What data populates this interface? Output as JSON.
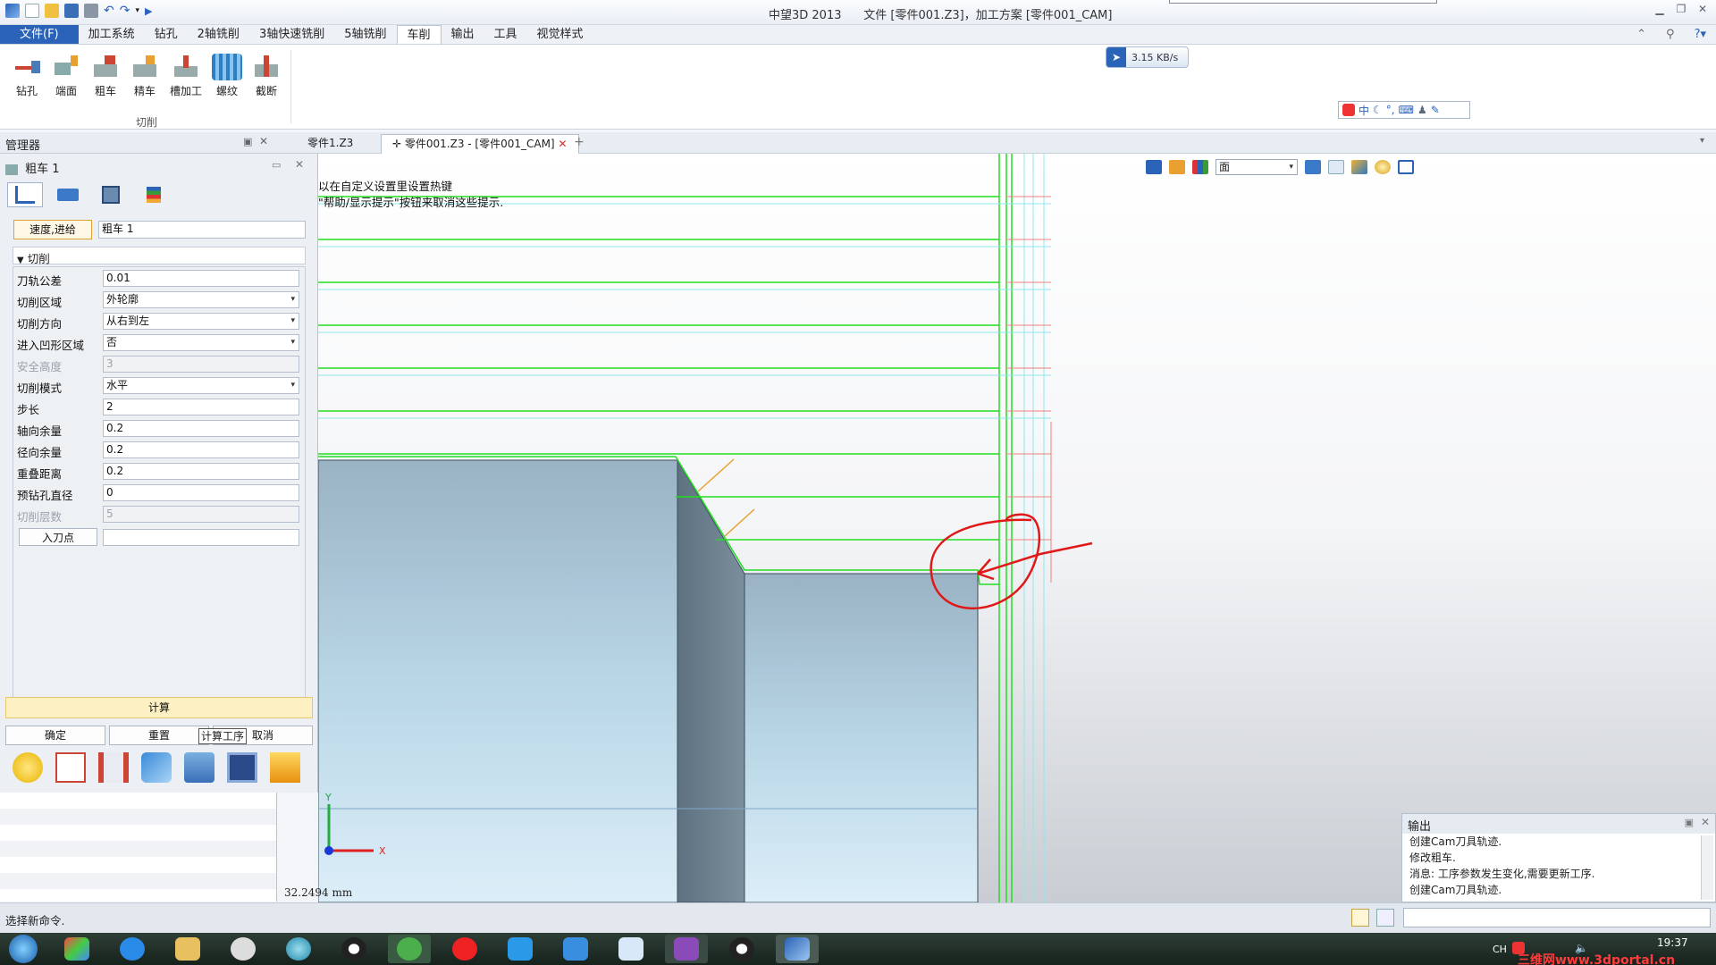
{
  "window": {
    "app_name": "中望3D 2013",
    "doc_title": "文件 [零件001.Z3]，加工方案 [零件001_CAM]"
  },
  "menu": [
    "文件(F)",
    "加工系统",
    "钻孔",
    "2轴铣削",
    "3轴快速铣削",
    "5轴铣削",
    "车削",
    "输出",
    "工具",
    "视觉样式"
  ],
  "ribbon": {
    "tools": [
      {
        "label": "钻孔",
        "icon": "drill-icon"
      },
      {
        "label": "端面",
        "icon": "facing-icon"
      },
      {
        "label": "粗车",
        "icon": "rough-turning-icon"
      },
      {
        "label": "精车",
        "icon": "finish-turning-icon"
      },
      {
        "label": "槽加工",
        "icon": "groove-icon"
      },
      {
        "label": "螺纹",
        "icon": "thread-icon"
      },
      {
        "label": "截断",
        "icon": "cutoff-icon"
      }
    ],
    "group_label": "切削"
  },
  "network": {
    "speed": "3.15 KB/s"
  },
  "ime": {
    "mode": "中"
  },
  "tabs": {
    "manager": "管理器",
    "docs": [
      "零件1.Z3",
      "零件001.Z3 - [零件001_CAM]"
    ]
  },
  "panel": {
    "title": "粗车 1",
    "feed_button": "速度,进给",
    "name_value": "粗车 1",
    "section": "切削",
    "rows": [
      {
        "label": "刀轨公差",
        "value": "0.01"
      },
      {
        "label": "切削区域",
        "value": "外轮廓"
      },
      {
        "label": "切削方向",
        "value": "从右到左"
      },
      {
        "label": "进入凹形区域",
        "value": "否"
      },
      {
        "label": "安全高度",
        "value": "3"
      },
      {
        "label": "切削模式",
        "value": "水平"
      },
      {
        "label": "步长",
        "value": "2"
      },
      {
        "label": "轴向余量",
        "value": "0.2"
      },
      {
        "label": "径向余量",
        "value": "0.2"
      },
      {
        "label": "重叠距离",
        "value": "0.2"
      },
      {
        "label": "预钻孔直径",
        "value": "0"
      },
      {
        "label": "切削层数",
        "value": "5"
      }
    ],
    "entry_button": "入刀点",
    "entry_value": "",
    "calc_button": "计算",
    "ok_button": "确定",
    "reset_button": "重置",
    "tooltip": "计算工序",
    "cancel_button": "取消"
  },
  "viewport": {
    "hint_line1": "以在自定义设置里设置热键",
    "hint_line2": "\"帮助/显示提示\"按钮来取消这些提示.",
    "filter_value": "面",
    "axis_x": "X",
    "axis_y": "Y",
    "scale": "32.2494 mm"
  },
  "output": {
    "title": "输出",
    "lines": [
      "创建Cam刀具轨迹.",
      "修改粗车.",
      "消息: 工序参数发生变化,需要更新工序.",
      "创建Cam刀具轨迹."
    ]
  },
  "status": {
    "text": "选择新命令."
  },
  "taskbar": {
    "lang": "CH",
    "time": "19:37",
    "watermark": "三维网www.3dportal.cn"
  },
  "colors": {
    "accent": "#2a63b7",
    "toolpath": "#22dd22",
    "annotation": "#e01818"
  }
}
